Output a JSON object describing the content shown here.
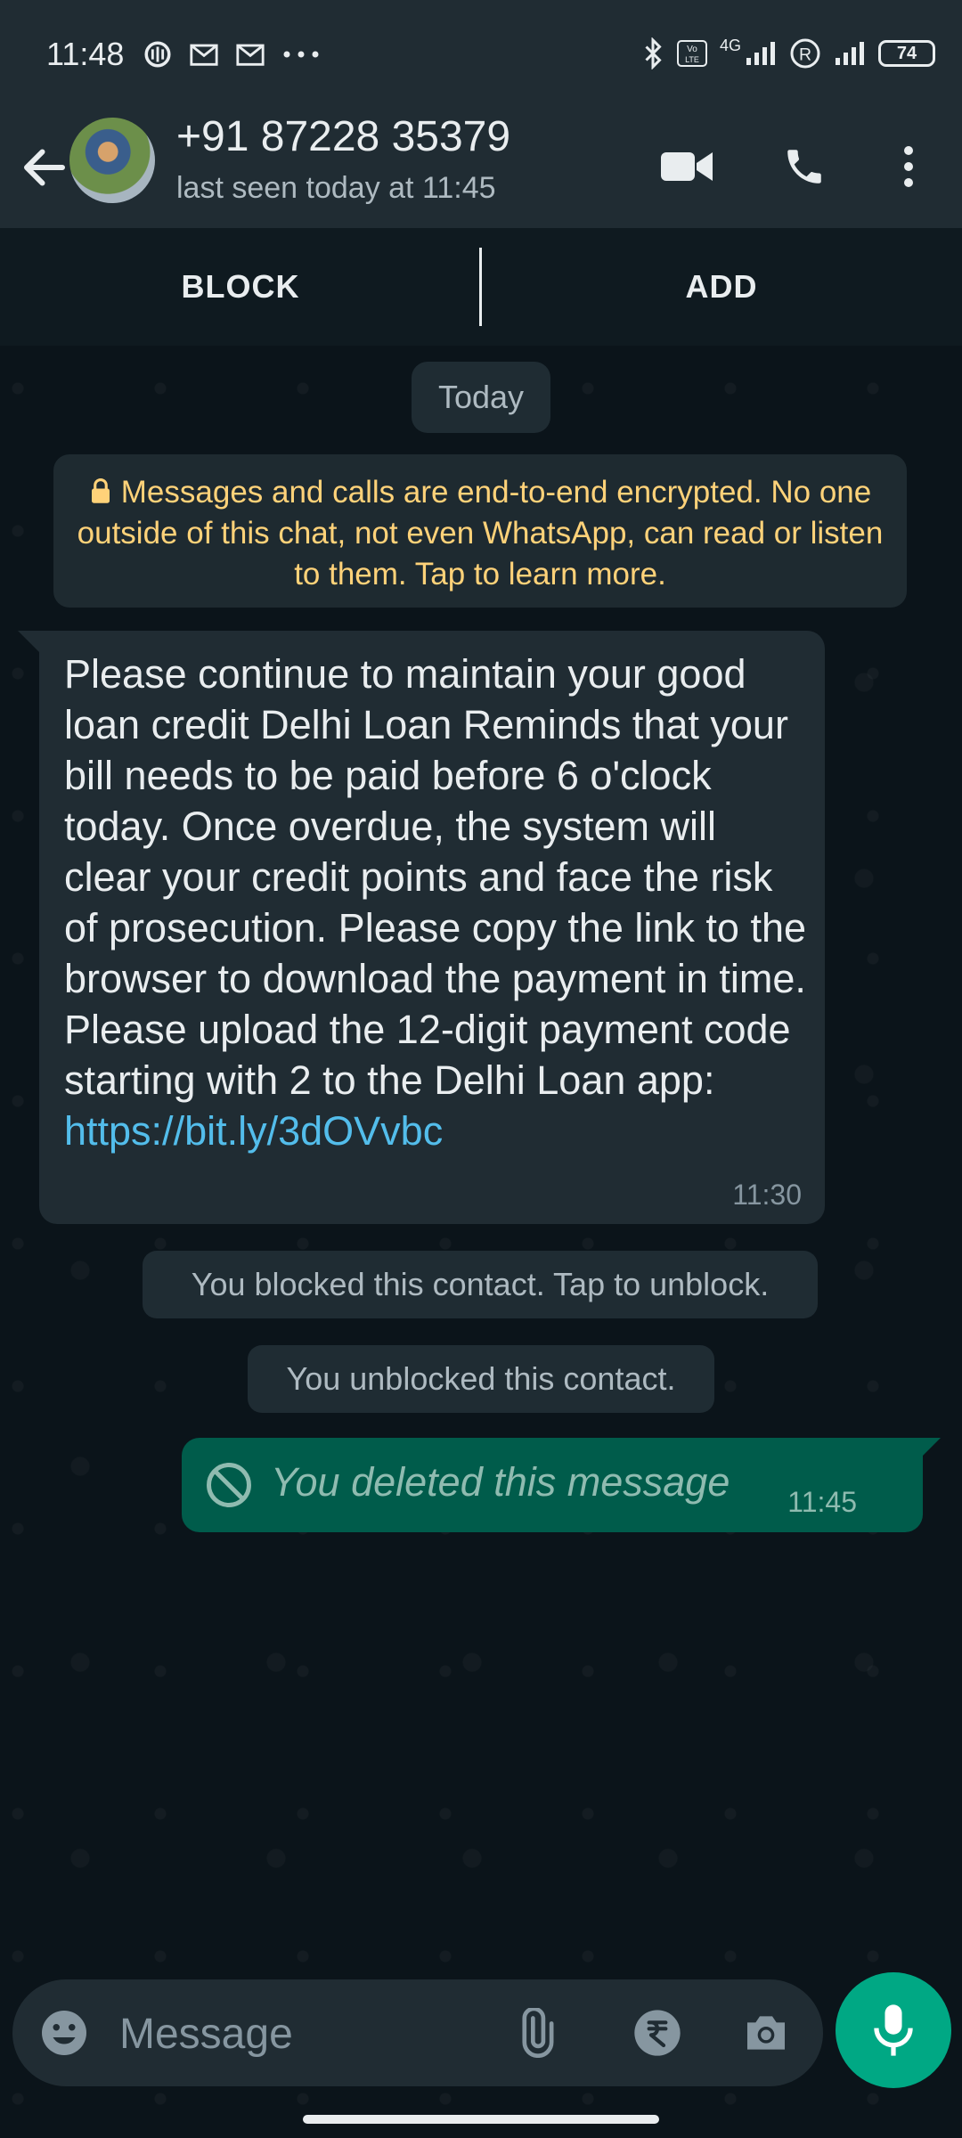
{
  "status_bar": {
    "time": "11:48",
    "battery": "74",
    "network": "4G"
  },
  "header": {
    "contact_name": "+91 87228 35379",
    "last_seen": "last seen today at 11:45"
  },
  "actions": {
    "block_label": "BLOCK",
    "add_label": "ADD"
  },
  "chat": {
    "date_chip": "Today",
    "encryption_notice": "Messages and calls are end-to-end encrypted. No one outside of this chat, not even WhatsApp, can read or listen to them. Tap to learn more.",
    "messages": [
      {
        "direction": "incoming",
        "text": "Please continue to maintain your good loan credit Delhi Loan Reminds that your bill needs to be paid before 6 o'clock today. Once overdue, the system will clear your credit points and face the risk of prosecution. Please copy the link to the browser to download the payment in time. Please upload the 12-digit payment code starting with 2 to the Delhi Loan app:",
        "link": "https://bit.ly/3dOVvbc",
        "time": "11:30"
      },
      {
        "direction": "system",
        "text": "You blocked this contact. Tap to unblock."
      },
      {
        "direction": "system",
        "text": "You unblocked this contact."
      },
      {
        "direction": "outgoing",
        "text": "You deleted this message",
        "time": "11:45"
      }
    ]
  },
  "composer": {
    "placeholder": "Message"
  },
  "colors": {
    "background": "#0b141a",
    "bar": "#202c33",
    "incoming_bubble": "#202c33",
    "outgoing_bubble": "#005c4b",
    "accent": "#00a884",
    "link": "#53bdeb",
    "notice_text": "#ffd279"
  },
  "icons": [
    "back-arrow-icon",
    "video-call-icon",
    "voice-call-icon",
    "more-options-icon",
    "lock-icon",
    "deleted-icon",
    "emoji-icon",
    "attach-icon",
    "rupee-icon",
    "camera-icon",
    "mic-icon"
  ]
}
